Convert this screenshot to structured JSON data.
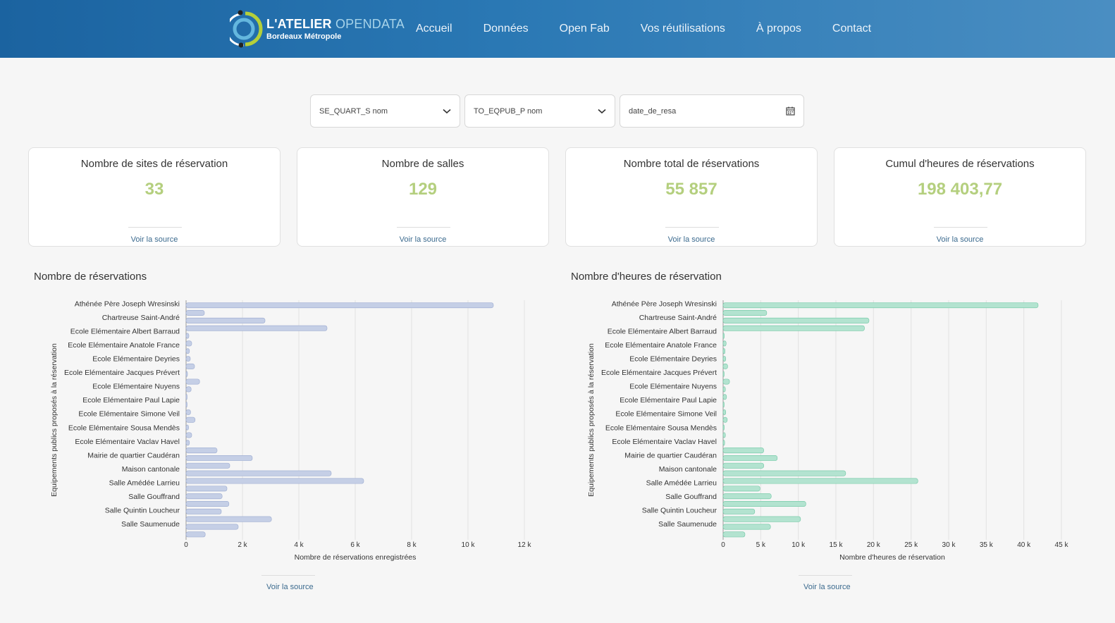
{
  "header": {
    "logo_main": "L'ATELIER ",
    "logo_accent": "OPENDATA",
    "logo_sub": "Bordeaux Métropole",
    "nav": [
      "Accueil",
      "Données",
      "Open Fab",
      "Vos réutilisations",
      "À propos",
      "Contact"
    ]
  },
  "filters": [
    {
      "label": "SE_QUART_S nom",
      "icon": "chevron-down-icon"
    },
    {
      "label": "TO_EQPUB_P nom",
      "icon": "chevron-down-icon"
    },
    {
      "label": "date_de_resa",
      "icon": "calendar-icon"
    }
  ],
  "kpis": [
    {
      "title": "Nombre de sites de réservation",
      "value": "33",
      "link": "Voir la source"
    },
    {
      "title": "Nombre de salles",
      "value": "129",
      "link": "Voir la source"
    },
    {
      "title": "Nombre total de réservations",
      "value": "55 857",
      "link": "Voir la source"
    },
    {
      "title": "Cumul d'heures de réservations",
      "value": "198 403,77",
      "link": "Voir la source"
    }
  ],
  "colors": {
    "kpi_value": "#b4cf7e",
    "chart1_bar": "#c5cfe6",
    "chart1_stroke": "#9aaad0",
    "chart2_bar": "#b3e3d0",
    "chart2_stroke": "#6fc7a3"
  },
  "chart_data": [
    {
      "type": "bar",
      "orientation": "horizontal",
      "title": "Nombre de réservations",
      "xlabel": "Nombre de réservations enregistrées",
      "ylabel": "Equipements publics proposés à la réservation",
      "xlim": [
        0,
        12000
      ],
      "xticks": [
        0,
        2000,
        4000,
        6000,
        8000,
        10000,
        12000
      ],
      "xtick_labels": [
        "0",
        "2 k",
        "4 k",
        "6 k",
        "8 k",
        "10 k",
        "12 k"
      ],
      "grid": true,
      "link": "Voir la source",
      "labels": [
        "Athénée Père Joseph Wresinski",
        "Chartreuse Saint-André",
        "Ecole Elémentaire Albert Barraud",
        "Ecole Elémentaire Anatole France",
        "Ecole Elémentaire Deyries",
        "Ecole Elémentaire Jacques Prévert",
        "Ecole Elémentaire Nuyens",
        "Ecole Elémentaire Paul Lapie",
        "Ecole Elémentaire Simone Veil",
        "Ecole Elémentaire Sousa Mendès",
        "Ecole Elémentaire Vaclav Havel",
        "Mairie de quartier Caudéran",
        "Maison cantonale",
        "Salle Amédée Larrieu",
        "Salle Gouffrand",
        "Salle Quintin Loucheur",
        "Salle Saumenude"
      ],
      "values": [
        10900,
        650,
        2800,
        5000,
        100,
        200,
        120,
        150,
        300,
        50,
        480,
        180,
        30,
        20,
        160,
        320,
        90,
        200,
        120,
        1100,
        2350,
        1550,
        5150,
        6300,
        1450,
        1280,
        1520,
        1250,
        3030,
        1850,
        680
      ]
    },
    {
      "type": "bar",
      "orientation": "horizontal",
      "title": "Nombre d'heures de réservation",
      "xlabel": "Nombre d'heures de réservation",
      "ylabel": "Equipements publics proposés à la réservation",
      "xlim": [
        0,
        45000
      ],
      "xticks": [
        0,
        5000,
        10000,
        15000,
        20000,
        25000,
        30000,
        35000,
        40000,
        45000
      ],
      "xtick_labels": [
        "0",
        "5 k",
        "10 k",
        "15 k",
        "20 k",
        "25 k",
        "30 k",
        "35 k",
        "40 k",
        "45 k"
      ],
      "grid": true,
      "link": "Voir la source",
      "labels": [
        "Athénée Père Joseph Wresinski",
        "Chartreuse Saint-André",
        "Ecole Elémentaire Albert Barraud",
        "Ecole Elémentaire Anatole France",
        "Ecole Elémentaire Deyries",
        "Ecole Elémentaire Jacques Prévert",
        "Ecole Elémentaire Nuyens",
        "Ecole Elémentaire Paul Lapie",
        "Ecole Elémentaire Simone Veil",
        "Ecole Elémentaire Sousa Mendès",
        "Ecole Elémentaire Vaclav Havel",
        "Mairie de quartier Caudéran",
        "Maison cantonale",
        "Salle Amédée Larrieu",
        "Salle Gouffrand",
        "Salle Quintin Loucheur",
        "Salle Saumenude"
      ],
      "values": [
        41900,
        5800,
        19400,
        18800,
        150,
        400,
        250,
        350,
        600,
        80,
        850,
        300,
        450,
        60,
        350,
        550,
        150,
        300,
        200,
        5400,
        7200,
        5400,
        16300,
        25900,
        4900,
        6400,
        11000,
        4200,
        10300,
        6300,
        2900
      ]
    }
  ]
}
